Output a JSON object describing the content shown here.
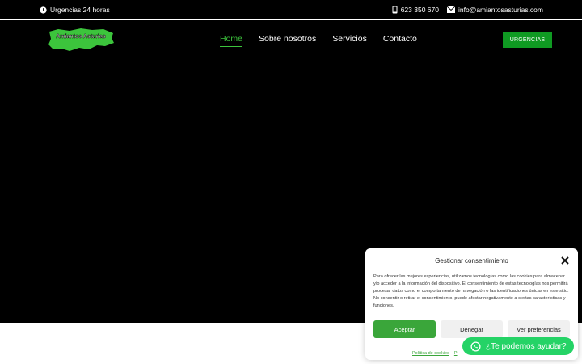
{
  "topbar": {
    "urgencias": "Urgencias 24 horas",
    "phone": "623 350 670",
    "email": "info@amiantosasturias.com"
  },
  "header": {
    "logo_text": "Amiantos Asturias",
    "nav": [
      {
        "label": "Home",
        "active": true
      },
      {
        "label": "Sobre nosotros",
        "active": false
      },
      {
        "label": "Servicios",
        "active": false
      },
      {
        "label": "Contacto",
        "active": false
      }
    ],
    "cta": "URGENCIAS"
  },
  "cookie": {
    "title": "Gestionar consentimiento",
    "text": "Para ofrecer las mejores experiencias, utilizamos tecnologías como las cookies para almacenar y/o acceder a la información del dispositivo. El consentimiento de estas tecnologías nos permitirá procesar datos como el comportamiento de navegación o las identificaciones únicas en este sitio. No consentir o retirar el consentimiento, puede afectar negativamente a ciertas características y funciones.",
    "accept": "Aceptar",
    "deny": "Denegar",
    "prefs": "Ver preferencias",
    "link_cookies": "Política de cookies",
    "link_privacy": "P"
  },
  "whatsapp": {
    "label": "¿Te podemos ayudar?"
  },
  "colors": {
    "brand_green": "#0f9a22",
    "nav_active": "#3cc43c",
    "whatsapp": "#25d366"
  }
}
